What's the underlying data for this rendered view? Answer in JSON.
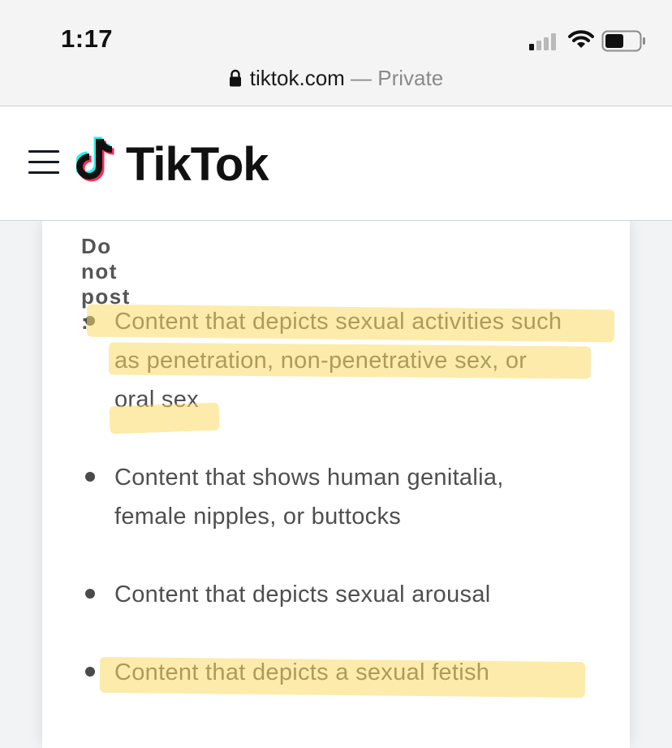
{
  "status_bar": {
    "time": "1:17"
  },
  "address_bar": {
    "domain": "tiktok.com",
    "separator": " — ",
    "mode": "Private"
  },
  "header": {
    "brand": "TikTok"
  },
  "content": {
    "section_title": "Do not post :",
    "rules": [
      {
        "line1": "Content that depicts sexual activities such",
        "line2": "as penetration, non-penetrative sex, or",
        "line3": "oral sex",
        "highlighted": true
      },
      {
        "line1": "Content that shows human genitalia,",
        "line2": "female nipples, or buttocks",
        "highlighted": false
      },
      {
        "line1": "Content that depicts sexual arousal",
        "highlighted": false
      },
      {
        "line1": "Content that depicts a sexual fetish",
        "highlighted": true
      }
    ]
  },
  "colors": {
    "highlight": "#fada64",
    "tiktok_cyan": "#25f4ee",
    "tiktok_red": "#fe2c55",
    "text": "#4f4f4f"
  }
}
